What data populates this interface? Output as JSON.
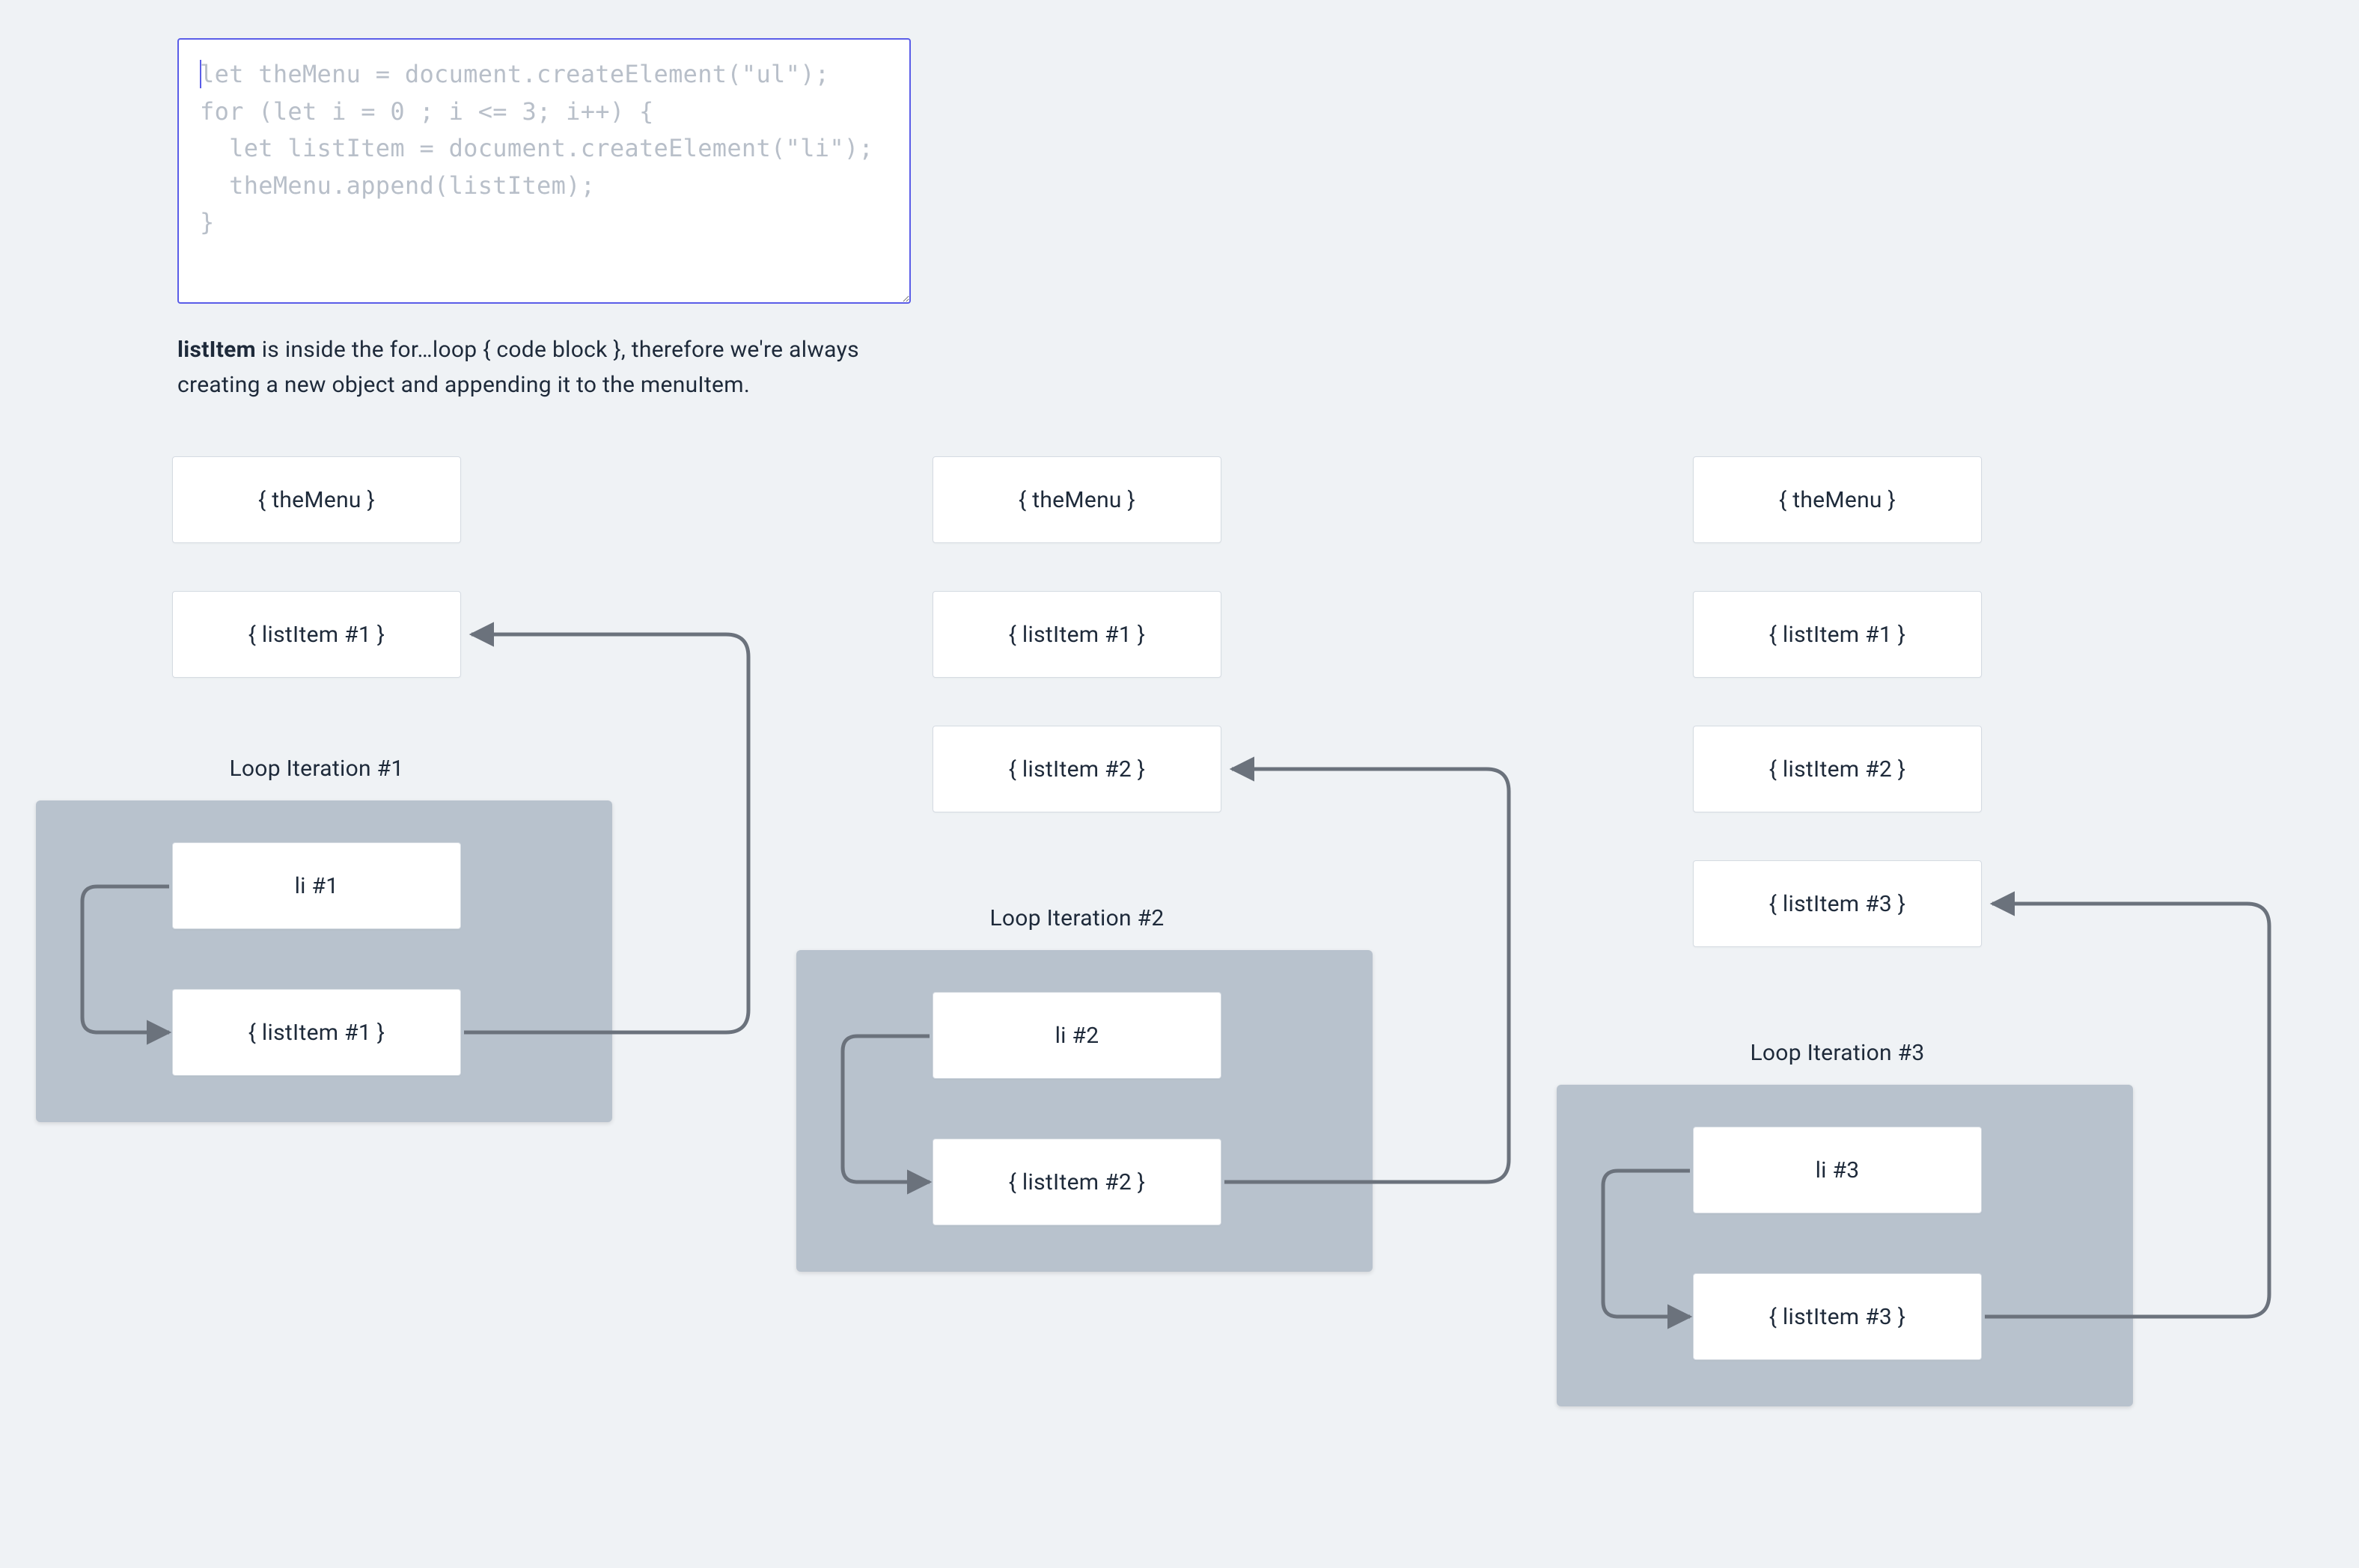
{
  "code": {
    "line1": "let theMenu = document.createElement(\"ul\");",
    "line2": "for (let i = 0 ; i <= 3; i++) {",
    "line3": "  let listItem = document.createElement(\"li\");",
    "line4": "  theMenu.append(listItem);",
    "line5": "}"
  },
  "caption_bold": "listItem",
  "caption_rest": " is inside the for…loop { code block }, therefore we're always creating a new object and appending it to the menuItem.",
  "columns": [
    {
      "stack": [
        "{ theMenu }",
        "{ listItem #1 }"
      ],
      "iter_label": "Loop Iteration #1",
      "iter_items": [
        "li #1",
        "{ listItem #1 }"
      ]
    },
    {
      "stack": [
        "{ theMenu }",
        "{ listItem #1 }",
        "{ listItem #2 }"
      ],
      "iter_label": "Loop Iteration #2",
      "iter_items": [
        "li #2",
        "{ listItem #2 }"
      ]
    },
    {
      "stack": [
        "{ theMenu }",
        "{ listItem #1 }",
        "{ listItem #2 }",
        "{ listItem #3 }"
      ],
      "iter_label": "Loop Iteration #3",
      "iter_items": [
        "li #3",
        "{ listItem #3 }"
      ]
    }
  ],
  "colors": {
    "page_bg": "#eff2f5",
    "node_bg": "#ffffff",
    "node_border": "#d5dbe2",
    "iter_bg": "#b8c2cd",
    "arrow": "#6b727c",
    "code_border": "#5a5de8",
    "code_text": "#b8bfc9"
  }
}
